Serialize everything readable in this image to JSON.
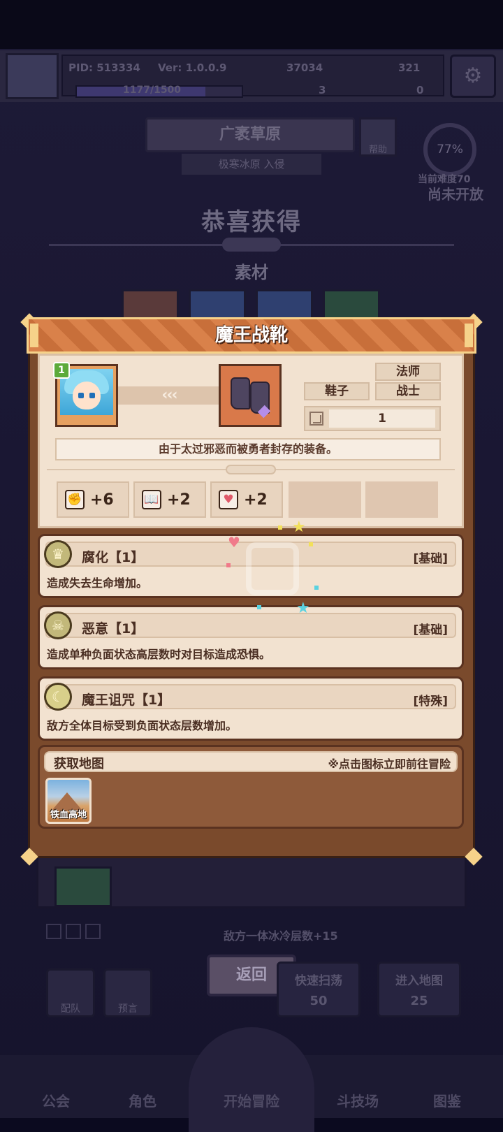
{
  "colors": {
    "page_bg": "#0b0a1f",
    "modal_header": "#d9814a",
    "modal_body": "#7a4a2c",
    "card_bg": "#f2e2d0",
    "text_dark": "#4a2e22",
    "level_badge": "#5caa3a"
  },
  "background": {
    "player": {
      "pid": "PID: 513334",
      "version": "Ver: 1.0.0.9",
      "gold": "37034",
      "gems": "321",
      "xp_text": "1177/1500",
      "xp_progress": 0.78,
      "item_a_count": "3",
      "item_b_count": "0"
    },
    "icons": [
      "avatar-icon",
      "gold-coin-icon",
      "gem-icon",
      "gear-icon",
      "help-icon"
    ],
    "region": "广袤草原",
    "subregion": "极寒冰原 入侵",
    "help_label": "帮助",
    "difficulty_percent": "77%",
    "difficulty_label": "当前难度70",
    "not_open": "尚未开放",
    "congrats_title": "恭喜获得",
    "materials_label": "素材",
    "enemy_effect_text": "敌方一体冰冷层数+15",
    "return_button": "返回",
    "team_button": "配队",
    "hint_button": "预言",
    "sweep_button": "快速扫荡",
    "sweep_cost": "50",
    "enter_map_button": "进入地图",
    "enter_map_cost": "25",
    "nav": {
      "guild": "公会",
      "character": "角色",
      "start_adventure": "开始冒险",
      "arena": "斗技场",
      "codex": "图鉴"
    }
  },
  "modal": {
    "title": "魔王战靴",
    "hero_level": "1",
    "arrows": "‹‹‹",
    "tags": {
      "class_mage": "法师",
      "slot": "鞋子",
      "class_warrior": "战士"
    },
    "quantity": "1",
    "description": "由于太过邪恶而被勇者封存的装备。",
    "stats": [
      {
        "icon": "fist-icon",
        "glyph": "✊",
        "value": "+6"
      },
      {
        "icon": "book-icon",
        "glyph": "📖",
        "value": "+2"
      },
      {
        "icon": "heart-icon",
        "glyph": "♥",
        "value": "+2"
      }
    ],
    "skills": [
      {
        "icon": "crown-icon",
        "glyph": "♛",
        "name": "腐化【1】",
        "type": "[基础]",
        "desc": "造成失去生命增加。"
      },
      {
        "icon": "skull-icon",
        "glyph": "☠",
        "name": "恶意【1】",
        "type": "[基础]",
        "desc": "造成单种负面状态高层数时对目标造成恐惧。"
      },
      {
        "icon": "moon-icon",
        "glyph": "☾",
        "name": "魔王诅咒【1】",
        "type": "[特殊]",
        "desc": "敌方全体目标受到负面状态层数增加。"
      }
    ],
    "map_section": {
      "title": "获取地图",
      "hint": "※点击图标立即前往冒险",
      "maps": [
        {
          "name": "铁血高地"
        }
      ]
    }
  }
}
